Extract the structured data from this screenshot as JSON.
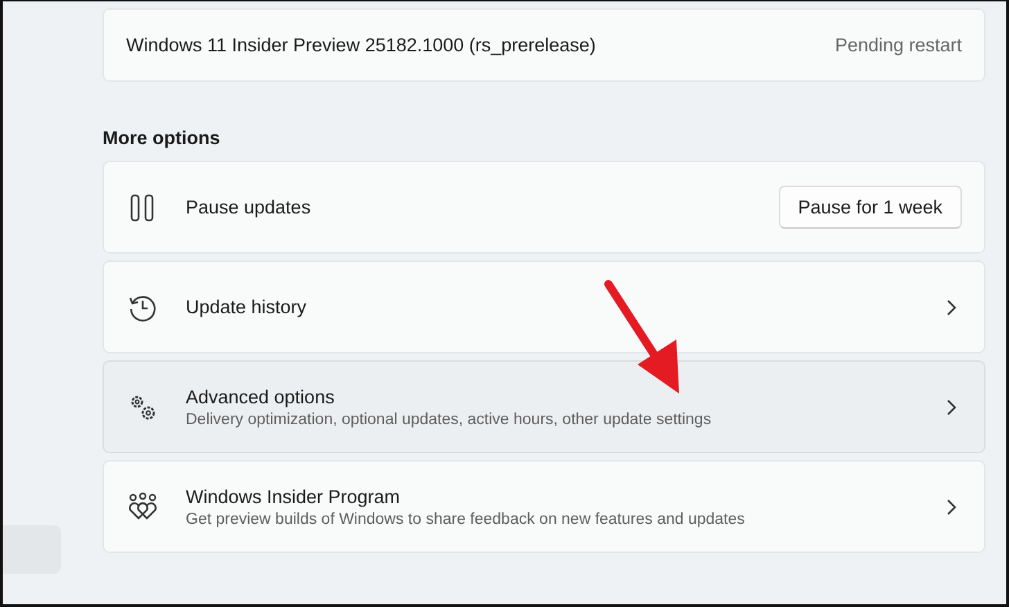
{
  "version_card": {
    "title": "Windows 11 Insider Preview 25182.1000 (rs_prerelease)",
    "status": "Pending restart"
  },
  "section_title": "More options",
  "options": [
    {
      "kind": "pause",
      "title": "Pause updates",
      "button": "Pause for 1 week",
      "highlighted": false
    },
    {
      "kind": "history",
      "title": "Update history",
      "highlighted": false
    },
    {
      "kind": "advanced",
      "title": "Advanced options",
      "subtitle": "Delivery optimization, optional updates, active hours, other update settings",
      "highlighted": true
    },
    {
      "kind": "insider",
      "title": "Windows Insider Program",
      "subtitle": "Get preview builds of Windows to share feedback on new features and updates",
      "highlighted": false
    }
  ]
}
